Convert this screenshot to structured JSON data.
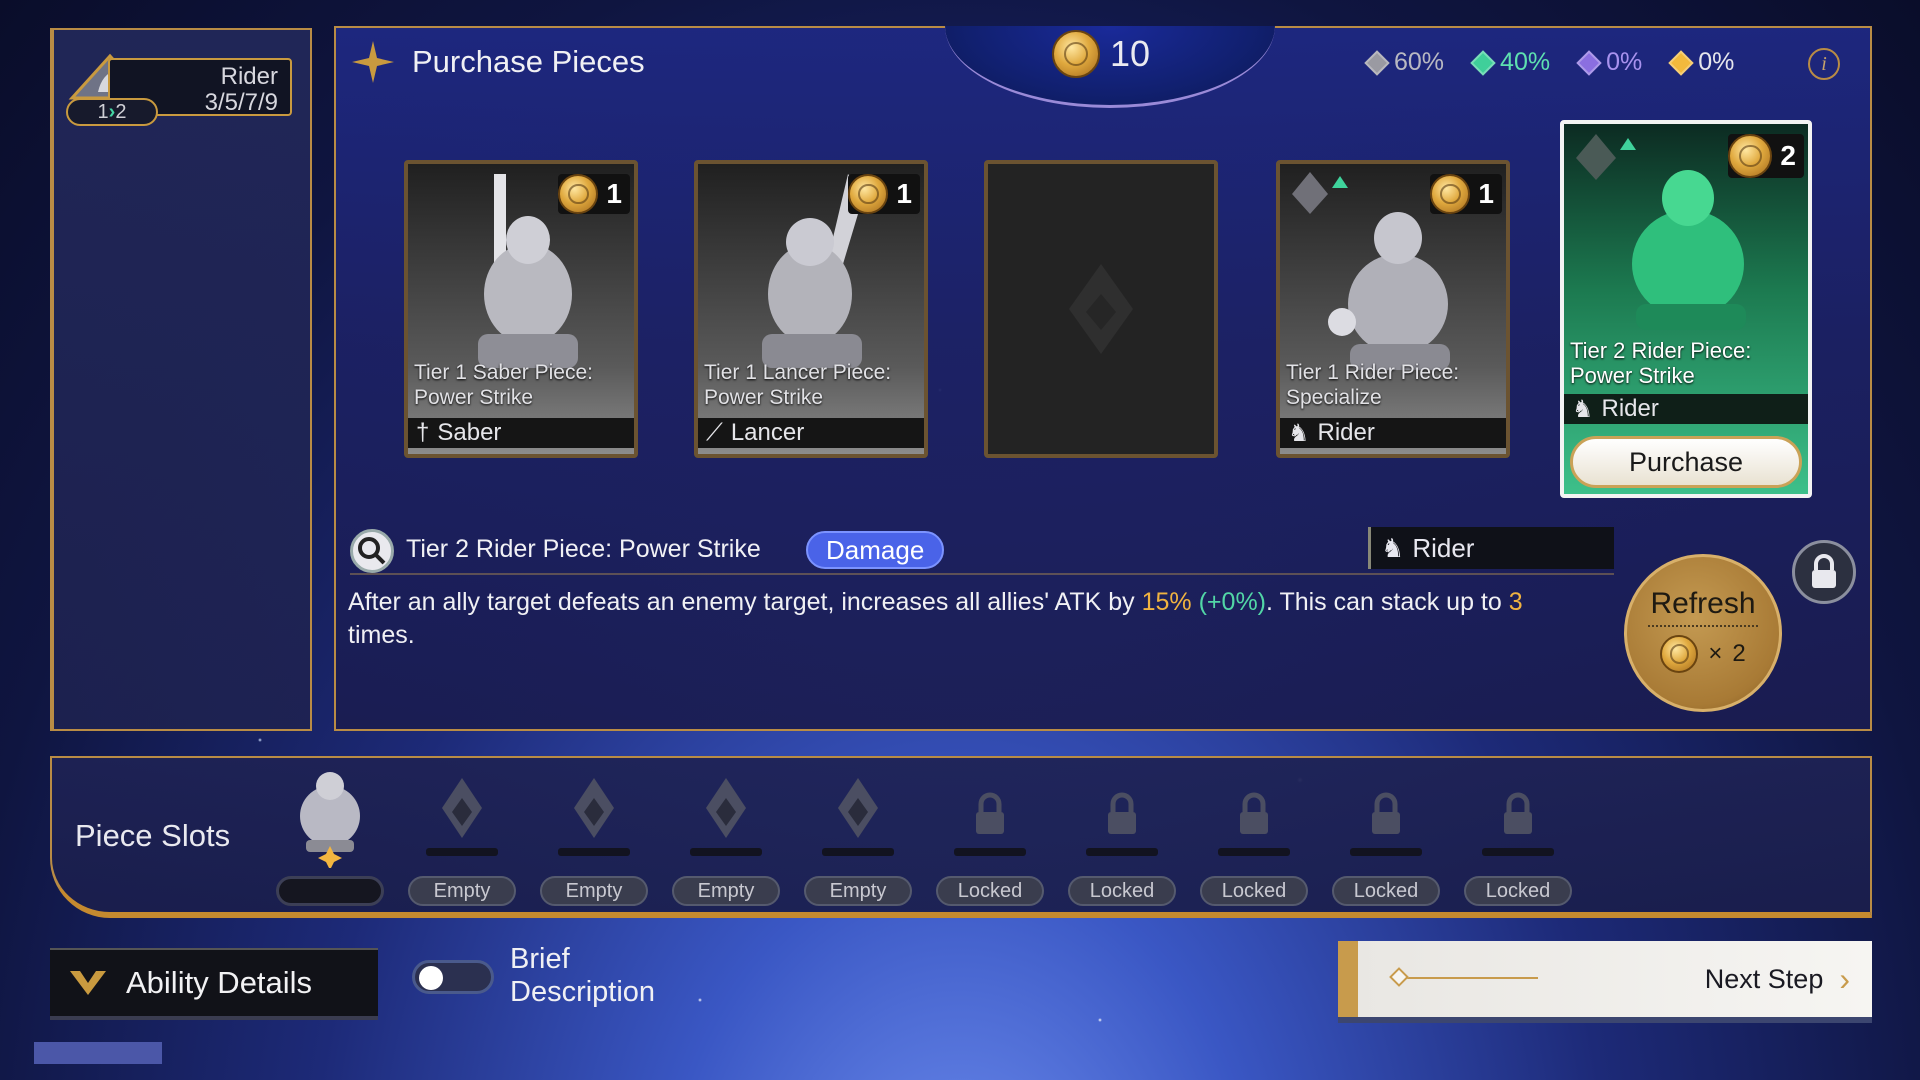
{
  "class_tag": {
    "name": "Rider",
    "thresholds": "3/5/7/9",
    "level_from": "1",
    "level_to": "2"
  },
  "header": {
    "title": "Purchase Pieces",
    "coins": "10",
    "info": "i"
  },
  "odds": [
    {
      "value": "60%",
      "color": "#9a9aa2"
    },
    {
      "value": "40%",
      "color": "#3fcf9a"
    },
    {
      "value": "0%",
      "color": "#8b6fe0"
    },
    {
      "value": "0%",
      "color": "#f2b93c"
    }
  ],
  "cards": [
    {
      "name": "Tier 1 Saber Piece: Power Strike",
      "class": "Saber",
      "cost": "1"
    },
    {
      "name": "Tier 1 Lancer Piece: Power Strike",
      "class": "Lancer",
      "cost": "1"
    },
    {
      "name": "",
      "class": "",
      "cost": ""
    },
    {
      "name": "Tier 1 Rider Piece: Specialize",
      "class": "Rider",
      "cost": "1"
    },
    {
      "name": "Tier 2 Rider Piece: Power Strike",
      "class": "Rider",
      "cost": "2",
      "action": "Purchase"
    }
  ],
  "detail": {
    "title": "Tier 2 Rider Piece: Power Strike",
    "tag": "Damage",
    "class": "Rider",
    "text_1": "After an ally target defeats an enemy target, increases all allies' ATK by ",
    "pct": "15%",
    "bonus": "(+0%)",
    "text_2": ". This can stack up to ",
    "stacks": "3",
    "text_3": " times."
  },
  "refresh": {
    "label": "Refresh",
    "times": "×",
    "cost": "2"
  },
  "slots": {
    "title": "Piece Slots",
    "items": [
      "",
      "Empty",
      "Empty",
      "Empty",
      "Empty",
      "Locked",
      "Locked",
      "Locked",
      "Locked",
      "Locked"
    ]
  },
  "footer": {
    "ability": "Ability Details",
    "brief_1": "Brief",
    "brief_2": "Description",
    "next": "Next Step"
  },
  "icons": [
    "shield-rider-icon",
    "sparkle-icon",
    "coin-icon",
    "gem-icon",
    "info-icon",
    "sword-icon",
    "lance-icon",
    "horse-icon",
    "search-icon",
    "lock-icon",
    "chevron-right-icon"
  ]
}
